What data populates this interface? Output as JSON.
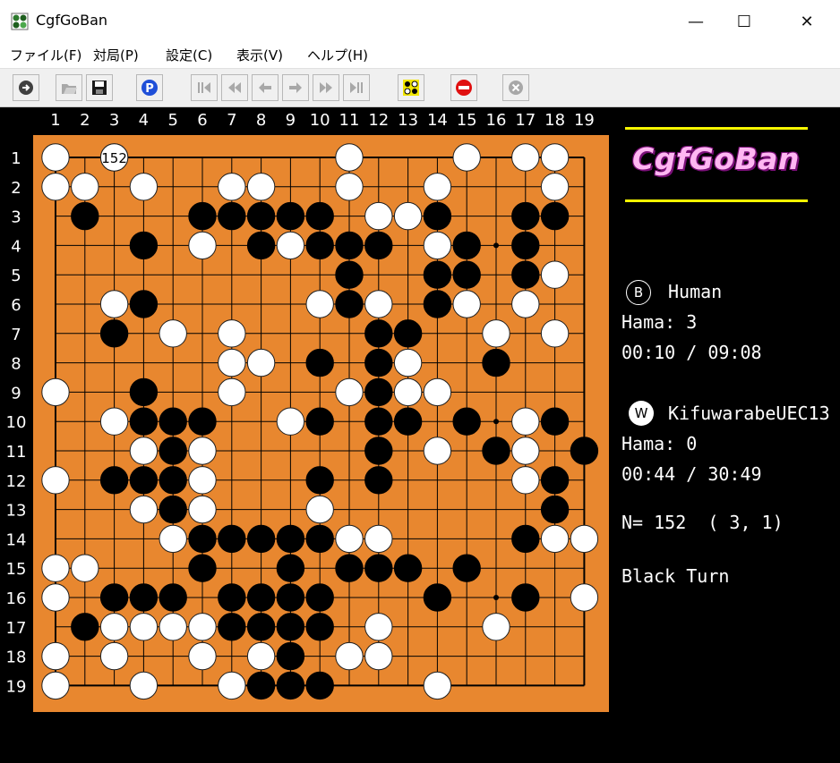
{
  "window": {
    "title": "CgfGoBan",
    "minimize": "—",
    "maximize": "☐",
    "close": "✕"
  },
  "menu": [
    {
      "label": "ファイル(F)"
    },
    {
      "label": "対局(P)"
    },
    {
      "label": "設定(C)"
    },
    {
      "label": "表示(V)"
    },
    {
      "label": "ヘルプ(H)"
    }
  ],
  "toolbar": [
    {
      "name": "pass-back-button",
      "icon": "circle-arrow-icon",
      "enabled": true
    },
    {
      "name": "open-button",
      "icon": "folder-open-icon",
      "enabled": false
    },
    {
      "name": "save-button",
      "icon": "floppy-disk-icon",
      "enabled": true
    },
    {
      "name": "pass-button",
      "icon": "pass-p-icon",
      "enabled": true
    },
    {
      "name": "first-move-button",
      "icon": "first-move-icon",
      "enabled": false
    },
    {
      "name": "back-ten-button",
      "icon": "fast-back-icon",
      "enabled": false
    },
    {
      "name": "back-one-button",
      "icon": "back-arrow-icon",
      "enabled": false
    },
    {
      "name": "forward-one-button",
      "icon": "forward-arrow-icon",
      "enabled": false
    },
    {
      "name": "forward-ten-button",
      "icon": "fast-forward-icon",
      "enabled": false
    },
    {
      "name": "last-move-button",
      "icon": "last-move-icon",
      "enabled": false
    },
    {
      "name": "board-setup-button",
      "icon": "board-setup-icon",
      "enabled": true
    },
    {
      "name": "stop-button",
      "icon": "stop-sign-icon",
      "enabled": true
    },
    {
      "name": "cancel-button",
      "icon": "cancel-x-icon",
      "enabled": false
    }
  ],
  "colors": {
    "board": "#e8872f",
    "background": "#000000",
    "logo_fill": "#ffb6f2",
    "logo_outline": "#7a0f78",
    "rule": "#f6f600"
  },
  "board": {
    "size": 19,
    "col_labels": [
      "1",
      "2",
      "3",
      "4",
      "5",
      "6",
      "7",
      "8",
      "9",
      "10",
      "11",
      "12",
      "13",
      "14",
      "15",
      "16",
      "17",
      "18",
      "19"
    ],
    "row_labels": [
      "1",
      "2",
      "3",
      "4",
      "5",
      "6",
      "7",
      "8",
      "9",
      "10",
      "11",
      "12",
      "13",
      "14",
      "15",
      "16",
      "17",
      "18",
      "19"
    ],
    "rows": [
      "W.W.......W...W.WW.",
      "WW.W..WW..W..W...W.",
      ".B...BBBBB.WWB..BB.",
      "...B.W.BWBBB.WB.B..",
      "..........B..BB.BW.",
      "..WB.....WBW.BW.W..",
      "..B.W.W....BB..W.W.",
      "......WW.B.BW..B...",
      "W..B..W...WBWW.....",
      "..WBBB..WB.BB.B.WB.",
      "...WBW.....B.W.BW.B",
      "W.BBBW...B.B....WB.",
      "...WBW...W.......B.",
      "....WBBBBBWW....BWW",
      "WW...B..B.BBB.B....",
      "W.BBB.BBBB...B..B.W",
      ".BWWWWBBBB.W...W...",
      "W.W..W.WB.WW.......",
      "W..W..WBBB...W....."
    ],
    "last_move": {
      "label": "152",
      "col": 3,
      "row": 1
    }
  },
  "sidebar": {
    "logo": "CgfGoBan",
    "black": {
      "badge": "B",
      "name": "Human",
      "hama": "Hama: 3",
      "time": "00:10 / 09:08"
    },
    "white": {
      "badge": "W",
      "name": "KifuwarabeUEC13",
      "hama": "Hama: 0",
      "time": "00:44 / 30:49"
    },
    "move_info": "N= 152  ( 3, 1)",
    "turn": "Black Turn"
  }
}
